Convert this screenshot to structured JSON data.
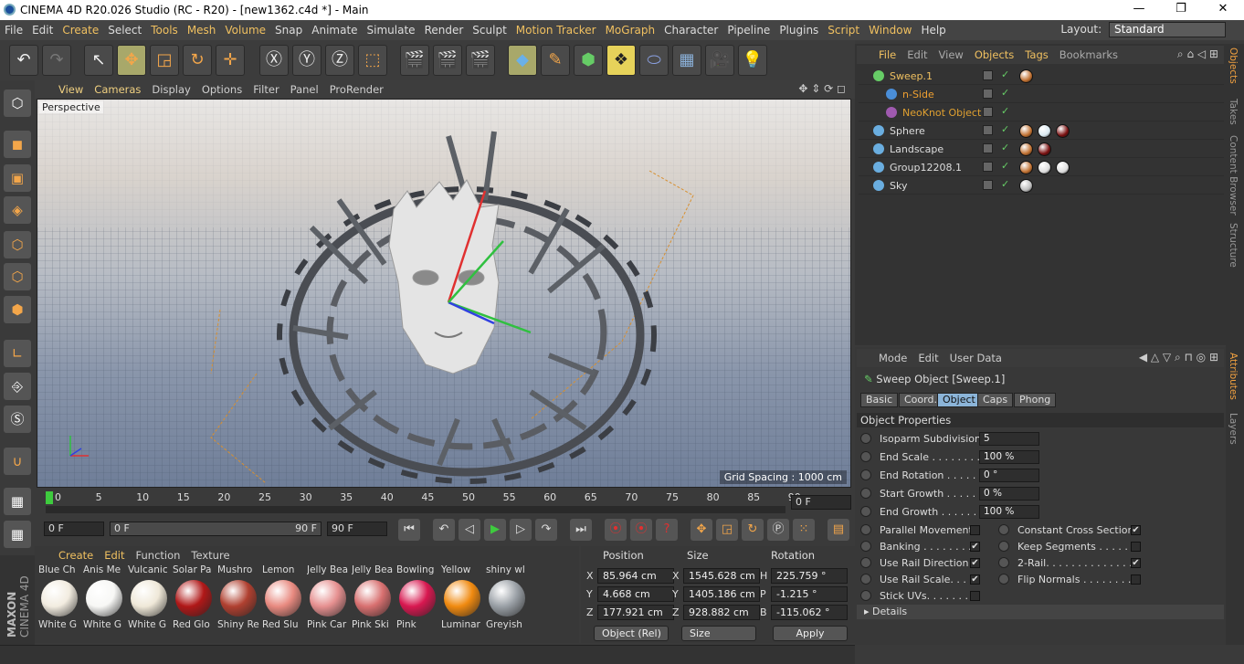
{
  "window": {
    "title": "CINEMA 4D R20.026 Studio (RC - R20) - [new1362.c4d *] - Main",
    "minimize": "—",
    "maximize": "❐",
    "close": "✕"
  },
  "menubar": {
    "items": [
      "File",
      "Edit",
      "Create",
      "Select",
      "Tools",
      "Mesh",
      "Volume",
      "Snap",
      "Animate",
      "Simulate",
      "Render",
      "Sculpt",
      "Motion Tracker",
      "MoGraph",
      "Character",
      "Pipeline",
      "Plugins",
      "Script",
      "Window",
      "Help"
    ],
    "layout_label": "Layout:",
    "layout_value": "Standard"
  },
  "viewport": {
    "menu": [
      "View",
      "Cameras",
      "Display",
      "Options",
      "Filter",
      "Panel",
      "ProRender"
    ],
    "camera": "Perspective",
    "grid_spacing": "Grid Spacing : 1000 cm"
  },
  "timeline": {
    "ticks": [
      "0",
      "5",
      "10",
      "15",
      "20",
      "25",
      "30",
      "35",
      "40",
      "45",
      "50",
      "55",
      "60",
      "65",
      "70",
      "75",
      "80",
      "85",
      "90"
    ],
    "current_frame": "0 F",
    "start": "0 F",
    "range_start": "0 F",
    "range_end": "90 F",
    "end": "90 F"
  },
  "materials": {
    "menu": [
      "Create",
      "Edit",
      "Function",
      "Texture"
    ],
    "top_row": [
      {
        "label": "Blue Ch",
        "color": "#3a4c6a"
      },
      {
        "label": "Anis Me",
        "color": "#7a7a7a"
      },
      {
        "label": "Vulcanic",
        "color": "#505050"
      },
      {
        "label": "Solar Pa",
        "color": "#2a3a6a"
      },
      {
        "label": "Mushro",
        "color": "#6a4a3a"
      },
      {
        "label": "Lemon",
        "color": "#c9c24a"
      },
      {
        "label": "Jelly Bea",
        "color": "#c04a6a"
      },
      {
        "label": "Jelly Bea",
        "color": "#6a3aa0"
      },
      {
        "label": "Bowling",
        "color": "#3a3a3a"
      },
      {
        "label": "Yellow",
        "color": "#d4b52a"
      },
      {
        "label": "shiny wl",
        "color": "#c8c8c8"
      }
    ],
    "items": [
      {
        "label": "White G",
        "color": "#f2ece0"
      },
      {
        "label": "White G",
        "color": "#f7f7f5"
      },
      {
        "label": "White G",
        "color": "#efe8d8"
      },
      {
        "label": "Red Glo",
        "color": "#b01818"
      },
      {
        "label": "Shiny Re",
        "color": "#b04030"
      },
      {
        "label": "Red Slu",
        "color": "#e88a80"
      },
      {
        "label": "Pink Car",
        "color": "#e69090"
      },
      {
        "label": "Pink Ski",
        "color": "#d87070"
      },
      {
        "label": "Pink",
        "color": "#d81850"
      },
      {
        "label": "Luminar",
        "color": "#f08a10"
      },
      {
        "label": "Greyish",
        "color": "#9aa0a6"
      }
    ]
  },
  "coordinates": {
    "headers": [
      "Position",
      "Size",
      "Rotation"
    ],
    "rows": [
      {
        "axis": "X",
        "pos": "85.964 cm",
        "size_axis": "X",
        "size": "1545.628 cm",
        "rot_axis": "H",
        "rot": "225.759 °"
      },
      {
        "axis": "Y",
        "pos": "4.668 cm",
        "size_axis": "Y",
        "size": "1405.186 cm",
        "rot_axis": "P",
        "rot": "-1.215 °"
      },
      {
        "axis": "Z",
        "pos": "177.921 cm",
        "size_axis": "Z",
        "size": "928.882 cm",
        "rot_axis": "B",
        "rot": "-115.062 °"
      }
    ],
    "mode": "Object (Rel)",
    "size_mode": "Size",
    "apply": "Apply"
  },
  "objects": {
    "menu": [
      "File",
      "Edit",
      "View",
      "Objects",
      "Tags",
      "Bookmarks"
    ],
    "items": [
      {
        "name": "Sweep.1",
        "indent": 0,
        "color": "#f0c060",
        "icon": "#6c6",
        "tags": [
          "#c07030"
        ]
      },
      {
        "name": "n-Side",
        "indent": 1,
        "color": "#f0a030",
        "icon": "#4a8ed8",
        "tags": []
      },
      {
        "name": "NeoKnot Object",
        "indent": 1,
        "color": "#e0a030",
        "icon": "#a05ab0",
        "tags": []
      },
      {
        "name": "Sphere",
        "indent": 0,
        "color": "#dddddd",
        "icon": "#6aaee0",
        "tags": [
          "#c07030",
          "#d8e8f0",
          "#7a1010"
        ]
      },
      {
        "name": "Landscape",
        "indent": 0,
        "color": "#dddddd",
        "icon": "#6aaee0",
        "tags": [
          "#c07030",
          "#7a1010"
        ]
      },
      {
        "name": "Group12208.1",
        "indent": 0,
        "color": "#dddddd",
        "icon": "#6aaee0",
        "tags": [
          "#c07030",
          "#dddddd",
          "#dddddd"
        ]
      },
      {
        "name": "Sky",
        "indent": 0,
        "color": "#dddddd",
        "icon": "#6aaee0",
        "tags": [
          "#bbbbbb"
        ]
      }
    ]
  },
  "side_tabs": [
    "Objects",
    "Takes",
    "Content Browser",
    "Structure",
    "Attributes",
    "Layers"
  ],
  "attributes": {
    "menu": [
      "Mode",
      "Edit",
      "User Data"
    ],
    "title": "Sweep Object [Sweep.1]",
    "tabs": [
      "Basic",
      "Coord.",
      "Object",
      "Caps",
      "Phong"
    ],
    "active_tab": "Object",
    "section": "Object Properties",
    "fields": [
      {
        "label": "Isoparm Subdivision",
        "value": "5"
      },
      {
        "label": "End Scale . . . . . . . . .",
        "value": "100 %"
      },
      {
        "label": "End Rotation . . . . . . .",
        "value": "0 °"
      },
      {
        "label": "Start Growth . . . . . .",
        "value": "0 %"
      },
      {
        "label": "End Growth . . . . . . .",
        "value": "100 %"
      }
    ],
    "checks_left": [
      {
        "label": "Parallel Movement",
        "checked": ""
      },
      {
        "label": "Banking . . . . . . . . .",
        "checked": "✔"
      },
      {
        "label": "Use Rail Direction",
        "checked": "✔"
      },
      {
        "label": "Use Rail Scale. . . .",
        "checked": "✔"
      },
      {
        "label": "Stick UVs. . . . . . . .",
        "checked": ""
      }
    ],
    "checks_right": [
      {
        "label": "Constant Cross Section",
        "checked": "✔"
      },
      {
        "label": "Keep Segments . . . . . .",
        "checked": ""
      },
      {
        "label": "2-Rail. . . . . . . . . . . . . .",
        "checked": "✔"
      },
      {
        "label": "Flip Normals . . . . . . . . .",
        "checked": ""
      }
    ],
    "details": "Details"
  },
  "brand": {
    "vendor": "MAXON",
    "product": "CINEMA 4D"
  }
}
